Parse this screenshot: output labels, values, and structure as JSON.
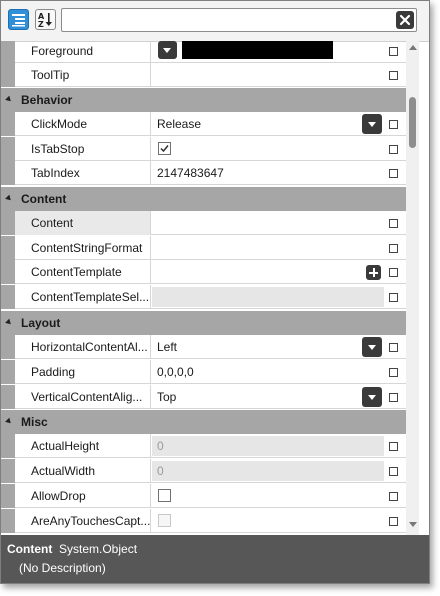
{
  "toolbar": {
    "categorized_icon": "categorized-list-icon",
    "alpha_icon": "alphabetical-sort-icon",
    "search_value": "",
    "clear_icon": "close-icon"
  },
  "properties": {
    "foreground": {
      "name": "Foreground",
      "color": "#000000"
    },
    "tooltip": {
      "name": "ToolTip",
      "value": ""
    },
    "behavior": {
      "category": "Behavior"
    },
    "clickmode": {
      "name": "ClickMode",
      "value": "Release"
    },
    "istabstop": {
      "name": "IsTabStop",
      "checked": true
    },
    "tabindex": {
      "name": "TabIndex",
      "value": "2147483647"
    },
    "content_cat": {
      "category": "Content"
    },
    "content": {
      "name": "Content",
      "value": ""
    },
    "contentstringformat": {
      "name": "ContentStringFormat",
      "value": ""
    },
    "contenttemplate": {
      "name": "ContentTemplate",
      "value": ""
    },
    "contenttemplatesel": {
      "name": "ContentTemplateSel...",
      "value": ""
    },
    "layout": {
      "category": "Layout"
    },
    "horizontalcontentalign": {
      "name": "HorizontalContentAl...",
      "value": "Left"
    },
    "padding": {
      "name": "Padding",
      "value": "0,0,0,0"
    },
    "verticalcontentalign": {
      "name": "VerticalContentAlig...",
      "value": "Top"
    },
    "misc": {
      "category": "Misc"
    },
    "actualheight": {
      "name": "ActualHeight",
      "value": "0"
    },
    "actualwidth": {
      "name": "ActualWidth",
      "value": "0"
    },
    "allowdrop": {
      "name": "AllowDrop",
      "checked": false
    },
    "areanytouchescaptured": {
      "name": "AreAnyTouchesCapt...",
      "checked": false
    }
  },
  "description": {
    "property": "Content",
    "type": "System.Object",
    "text": "(No Description)"
  },
  "colors": {
    "accent": "#2f8fd8",
    "category_bg": "#a6a6a6",
    "description_bg": "#575757",
    "button_dark": "#3a3a3a"
  }
}
